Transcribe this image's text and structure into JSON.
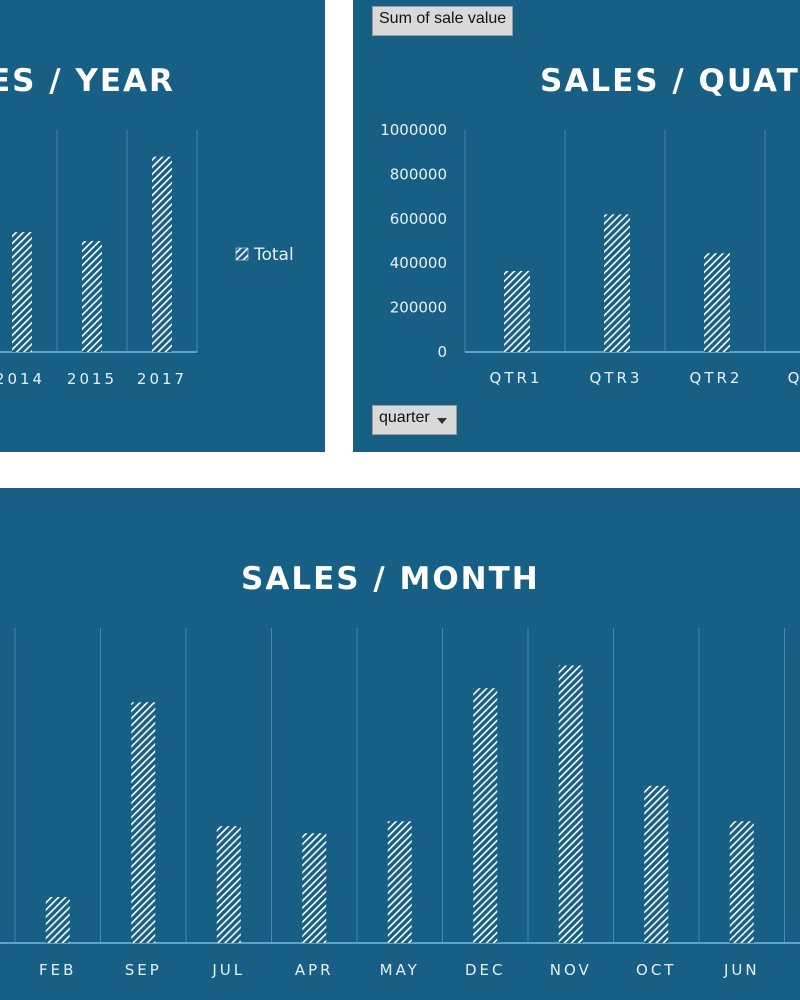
{
  "theme": {
    "panel_bg": "#175f84",
    "bar_fill": "#ffffff",
    "grid_color": "#4a87a8",
    "axis_color": "#5ba3cc"
  },
  "pivot": {
    "value_field_label": "Sum of sale value",
    "quarter_field_label": "quarter"
  },
  "chart_data": [
    {
      "type": "bar",
      "title": "ES / YEAR",
      "categories": [
        "2014",
        "2015",
        "2017"
      ],
      "visible_tick_labels": [
        "2014",
        "2015",
        "2017"
      ],
      "series": [
        {
          "name": "Total",
          "values": [
            540000,
            500000,
            880000
          ]
        }
      ],
      "ylim": [
        0,
        1000000
      ],
      "legend": "right",
      "legend_label": "Total",
      "grid": true
    },
    {
      "type": "bar",
      "title": "SALES / QUATER",
      "categories": [
        "QTR1",
        "QTR3",
        "QTR2",
        "Q"
      ],
      "series": [
        {
          "values": [
            365000,
            620000,
            445000
          ]
        }
      ],
      "yticks": [
        "0",
        "200000",
        "400000",
        "600000",
        "800000",
        "1000000"
      ],
      "ylim": [
        0,
        1000000
      ],
      "grid": true
    },
    {
      "type": "bar",
      "title": "SALES / MONTH",
      "categories": [
        "FEB",
        "SEP",
        "JUL",
        "APR",
        "MAY",
        "DEC",
        "NOV",
        "OCT",
        "JUN"
      ],
      "series": [
        {
          "values": [
            65000,
            340000,
            165000,
            155000,
            172000,
            360000,
            392000,
            222000,
            172000
          ]
        }
      ],
      "ylim": [
        0,
        445000
      ],
      "grid": true
    }
  ]
}
